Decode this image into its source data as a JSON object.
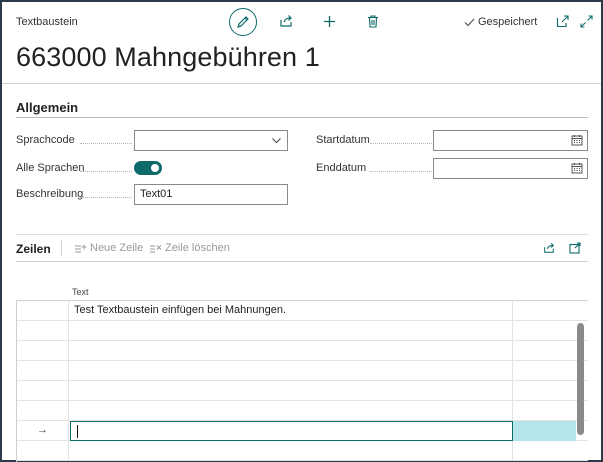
{
  "header": {
    "caption": "Textbaustein",
    "saved_status": "Gespeichert",
    "title": "663000 Mahngebühren 1"
  },
  "general": {
    "section_title": "Allgemein",
    "language_code": {
      "label": "Sprachcode",
      "value": ""
    },
    "all_languages": {
      "label": "Alle Sprachen",
      "enabled": true
    },
    "description": {
      "label": "Beschreibung",
      "value": "Text01"
    },
    "start_date": {
      "label": "Startdatum",
      "value": ""
    },
    "end_date": {
      "label": "Enddatum",
      "value": ""
    }
  },
  "lines": {
    "title": "Zeilen",
    "new_line_label": "Neue Zeile",
    "delete_line_label": "Zeile löschen",
    "column_text": "Text",
    "rows": [
      {
        "text": "Test Textbaustein einfügen bei Mahnungen."
      },
      {
        "text": ""
      },
      {
        "text": ""
      },
      {
        "text": ""
      },
      {
        "text": ""
      },
      {
        "text": ""
      }
    ],
    "active_row_marker": "→"
  },
  "colors": {
    "accent": "#0f6a6a",
    "active_cell": "#b3e5ea"
  }
}
